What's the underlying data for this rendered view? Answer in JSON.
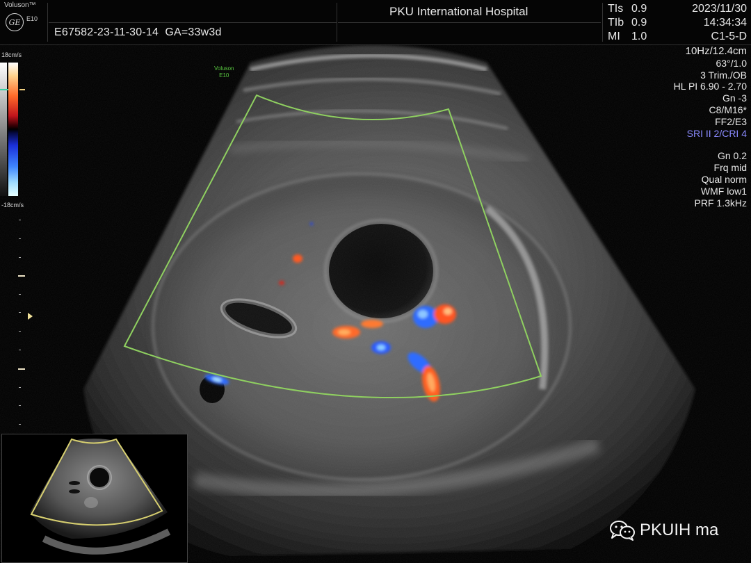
{
  "header": {
    "brand": "Voluson™",
    "model": "E10",
    "logo_icon": "ge-logo-icon",
    "patient_id": "E67582-23-11-30-14",
    "ga": "GA=33w3d",
    "hospital": "PKU International Hospital",
    "indices": [
      {
        "label": "TIs",
        "value": "0.9"
      },
      {
        "label": "TIb",
        "value": "0.9"
      },
      {
        "label": "MI",
        "value": "1.0"
      }
    ],
    "date": "2023/11/30",
    "time": "14:34:34",
    "probe": "C1-5-D"
  },
  "params": {
    "frame": "10Hz/12.4cm",
    "angle": "63°/1.0",
    "preset": "3 Trim./OB",
    "hl_pi": "HL PI 6.90 - 2.70",
    "gn": "Gn  -3",
    "cm": "C8/M16*",
    "ff": "FF2/E3",
    "sri": "SRI II 2/CRI 4",
    "color_gn": "Gn  0.2",
    "frq": "Frq mid",
    "qual": "Qual norm",
    "wmf": "WMF low1",
    "prf": "PRF  1.3kHz"
  },
  "colorbar": {
    "top_label": "18cm/s",
    "bottom_label": "-18cm/s"
  },
  "image_watermark": {
    "line1": "Voluson",
    "line2": "E10"
  },
  "footer": {
    "wechat_icon": "wechat-icon",
    "account": "PKUIH ma"
  }
}
